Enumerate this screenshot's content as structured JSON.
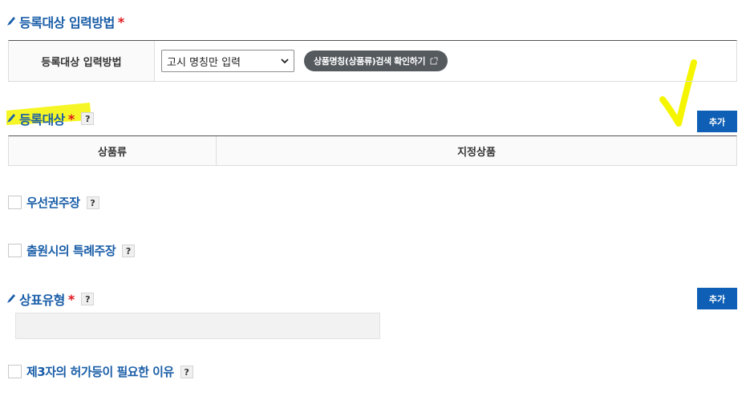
{
  "method_section": {
    "title": "등록대상 입력방법",
    "required_mark": "*",
    "row_label": "등록대상 입력방법",
    "select_value": "고시 명칭만 입력",
    "check_button_label": "상품명칭(상품류)검색 확인하기"
  },
  "target_section": {
    "title": "등록대상",
    "required_mark": "*",
    "help": "?",
    "add_label": "추가",
    "columns": [
      "상품류",
      "지정상품"
    ]
  },
  "priority": {
    "label": "우선권주장",
    "help": "?"
  },
  "exception": {
    "label": "출원시의 특례주장",
    "help": "?"
  },
  "trademark_type": {
    "title": "상표유형",
    "required_mark": "*",
    "help": "?",
    "add_label": "추가"
  },
  "third_party": {
    "label": "제3자의 허가등이 필요한 이유",
    "help": "?"
  },
  "colors": {
    "heading_blue": "#1a5ea8",
    "button_blue": "#0e5fb5",
    "required_red": "#e0161d",
    "pill_gray": "#555a5f",
    "highlight_yellow": "#f5f500"
  }
}
